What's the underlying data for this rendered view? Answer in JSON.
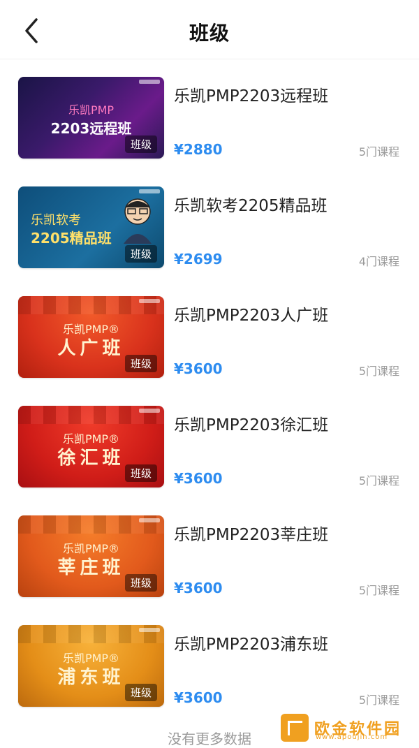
{
  "header": {
    "title": "班级"
  },
  "courses": [
    {
      "name": "乐凯PMP2203远程班",
      "price": "¥2880",
      "count": "5门课程",
      "thumb": {
        "line1": "乐凯PMP",
        "line2": "2203远程班",
        "badge": "班级"
      }
    },
    {
      "name": "乐凯软考2205精品班",
      "price": "¥2699",
      "count": "4门课程",
      "thumb": {
        "line1": "乐凯软考",
        "line2": "2205精品班",
        "badge": "班级"
      }
    },
    {
      "name": "乐凯PMP2203人广班",
      "price": "¥3600",
      "count": "5门课程",
      "thumb": {
        "line1": "乐凯PMP®",
        "line2": "人广班",
        "badge": "班级"
      }
    },
    {
      "name": "乐凯PMP2203徐汇班",
      "price": "¥3600",
      "count": "5门课程",
      "thumb": {
        "line1": "乐凯PMP®",
        "line2": "徐汇班",
        "badge": "班级"
      }
    },
    {
      "name": "乐凯PMP2203莘庄班",
      "price": "¥3600",
      "count": "5门课程",
      "thumb": {
        "line1": "乐凯PMP®",
        "line2": "莘庄班",
        "badge": "班级"
      }
    },
    {
      "name": "乐凯PMP2203浦东班",
      "price": "¥3600",
      "count": "5门课程",
      "thumb": {
        "line1": "乐凯PMP®",
        "line2": "浦东班",
        "badge": "班级"
      }
    }
  ],
  "footer": {
    "text": "没有更多数据"
  },
  "watermark": {
    "text": "欧金软件园",
    "sub": "www.apoujin.com"
  },
  "colors": {
    "price": "#2d8cf0",
    "muted": "#9a9a9a"
  }
}
